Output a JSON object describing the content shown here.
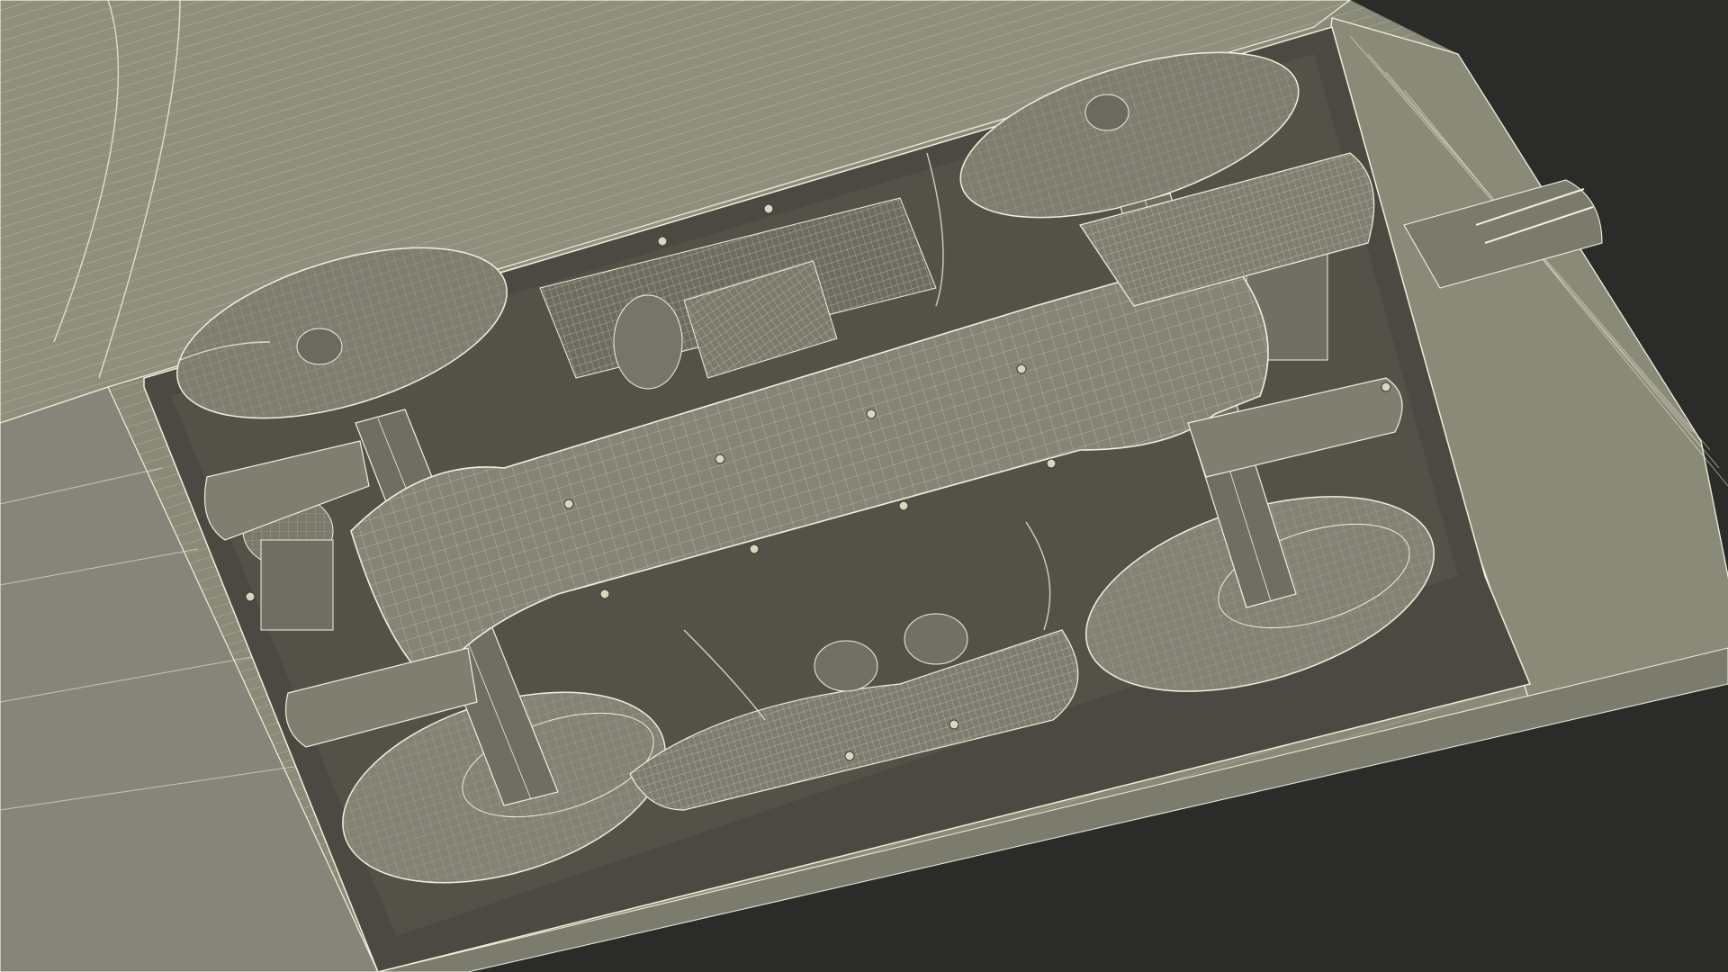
{
  "scene": {
    "subject": "wireframe-render-train-bogie-underside",
    "background_color": "#2b2b2a",
    "body_color": "#8a8a78",
    "shadow_color": "#4a4a42",
    "wire_color": "#f1f0dc",
    "bolt_count": 14
  }
}
